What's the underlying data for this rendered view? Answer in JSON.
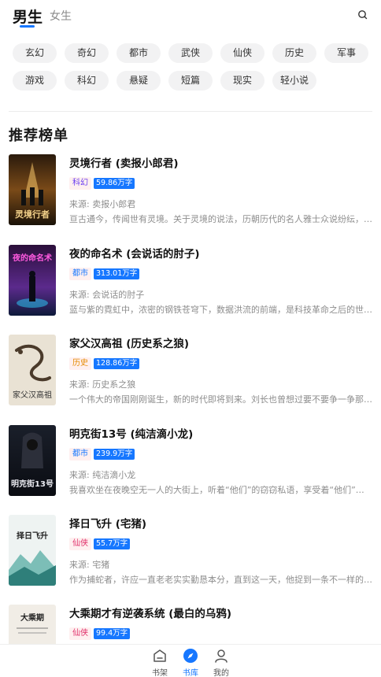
{
  "header": {
    "tab_male": "男生",
    "tab_female": "女生",
    "search_icon": "search-icon"
  },
  "chips": [
    "玄幻",
    "奇幻",
    "都市",
    "武侠",
    "仙侠",
    "历史",
    "军事",
    "游戏",
    "科幻",
    "悬疑",
    "短篇",
    "现实",
    "轻小说"
  ],
  "section_title": "推荐榜单",
  "books": [
    {
      "title": "灵境行者 (卖报小郎君)",
      "genre": "科幻",
      "genre_color": "#6a3df0",
      "words": "59.86万字",
      "source": "来源: 卖报小郎君",
      "desc": "亘古通今，传闻世有灵境。关于灵境的说法，历朝历代的名人雅士众说纷纭，有人说灵境是神仙居住的地方。",
      "cover_text": "灵境行者"
    },
    {
      "title": "夜的命名术 (会说话的肘子)",
      "genre": "都市",
      "genre_color": "#1677ff",
      "words": "313.01万字",
      "source": "来源: 会说话的肘子",
      "desc": "蓝与紫的霓虹中，浓密的钢铁苍穹下，数据洪流的前端，是科技革命之后的世界。",
      "cover_text": "夜的命名术"
    },
    {
      "title": "家父汉高祖 (历史系之狼)",
      "genre": "历史",
      "genre_color": "#e58a00",
      "words": "128.86万字",
      "source": "来源: 历史系之狼",
      "desc": "一个伟大的帝国刚刚诞生，新的时代即将到来。刘长也曾想过要不要争一争那个位置。",
      "cover_text": "家父汉高祖"
    },
    {
      "title": "明克街13号 (纯洁滴小龙)",
      "genre": "都市",
      "genre_color": "#1677ff",
      "words": "239.9万字",
      "source": "来源: 纯洁滴小龙",
      "desc": "我喜欢坐在夜晚空无一人的大街上，听着“他们”的窃窃私语，享受着“他们”的喧嚣。",
      "cover_text": "明克街13号"
    },
    {
      "title": "择日飞升 (宅猪)",
      "genre": "仙侠",
      "genre_color": "#e0306a",
      "words": "55.7万字",
      "source": "来源: 宅猪",
      "desc": "作为捕蛇者，许应一直老老实实勤恳本分，直到这一天，他捉到一条不一样的蛇。",
      "cover_text": "择日飞升"
    },
    {
      "title": "大乘期才有逆袭系统 (最白的乌鸦)",
      "genre": "仙侠",
      "genre_color": "#e0306a",
      "words": "99.4万字",
      "source": "",
      "desc": "",
      "cover_text": "大乘期"
    }
  ],
  "bottom_nav": [
    {
      "label": "书架",
      "icon": "bookshelf-icon",
      "active": false
    },
    {
      "label": "书库",
      "icon": "compass-icon",
      "active": true
    },
    {
      "label": "我的",
      "icon": "profile-icon",
      "active": false
    }
  ],
  "colors": {
    "accent": "#1677ff",
    "chip_bg": "#f2f2f3",
    "muted_text": "#8d8d8d"
  }
}
